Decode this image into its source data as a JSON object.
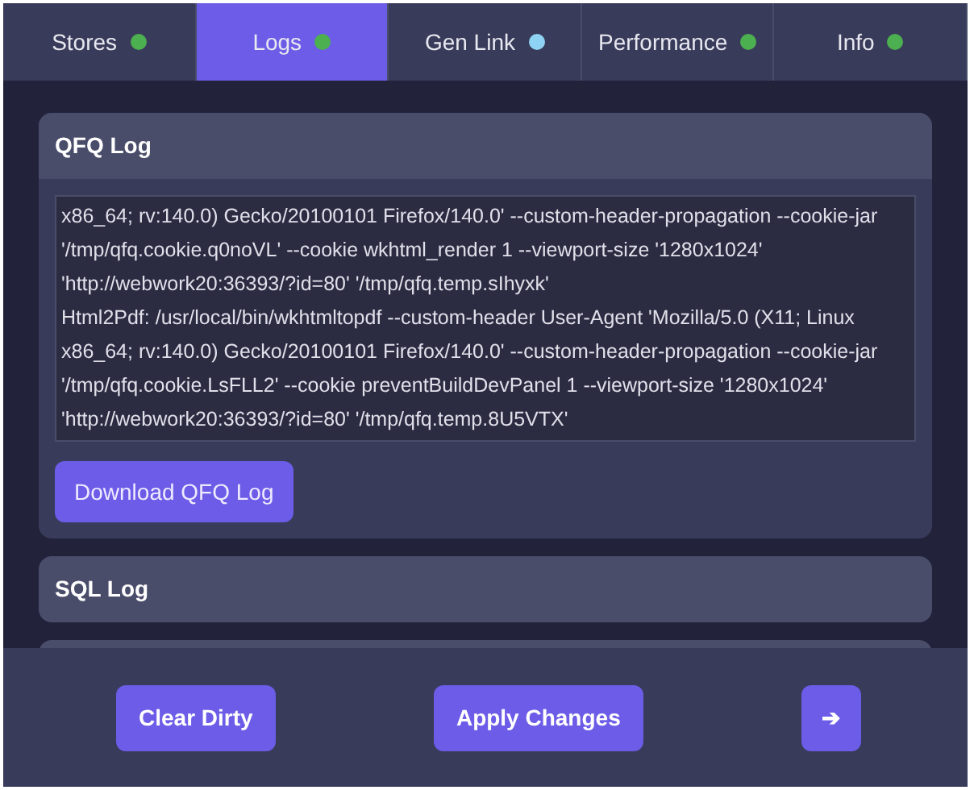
{
  "tabs": [
    {
      "label": "Stores",
      "selected": false,
      "color": "#4caf50"
    },
    {
      "label": "Logs",
      "selected": true,
      "color": "#4caf50"
    },
    {
      "label": "Gen Link",
      "selected": false,
      "color": "#8fd3f4"
    },
    {
      "label": "Performance",
      "selected": false,
      "color": "#4caf50"
    },
    {
      "label": "Info",
      "selected": false,
      "color": "#4caf50"
    }
  ],
  "panels": [
    {
      "title": "QFQ Log",
      "expanded": true,
      "log_entries": [
        "x86_64; rv:140.0) Gecko/20100101 Firefox/140.0' --custom-header-propagation --cookie-jar '/tmp/qfq.cookie.q0noVL' --cookie wkhtml_render 1 --viewport-size '1280x1024' 'http://webwork20:36393/?id=80' '/tmp/qfq.temp.sIhyxk'",
        "Html2Pdf: /usr/local/bin/wkhtmltopdf --custom-header User-Agent 'Mozilla/5.0 (X11; Linux x86_64; rv:140.0) Gecko/20100101 Firefox/140.0' --custom-header-propagation --cookie-jar '/tmp/qfq.cookie.LsFLL2' --cookie preventBuildDevPanel 1 --viewport-size '1280x1024' 'http://webwork20:36393/?id=80' '/tmp/qfq.temp.8U5VTX'"
      ],
      "button": "Download QFQ Log"
    },
    {
      "title": "SQL Log",
      "expanded": false
    }
  ],
  "footer_buttons": [
    "Clear Dirty",
    "Apply Changes",
    "➔"
  ]
}
